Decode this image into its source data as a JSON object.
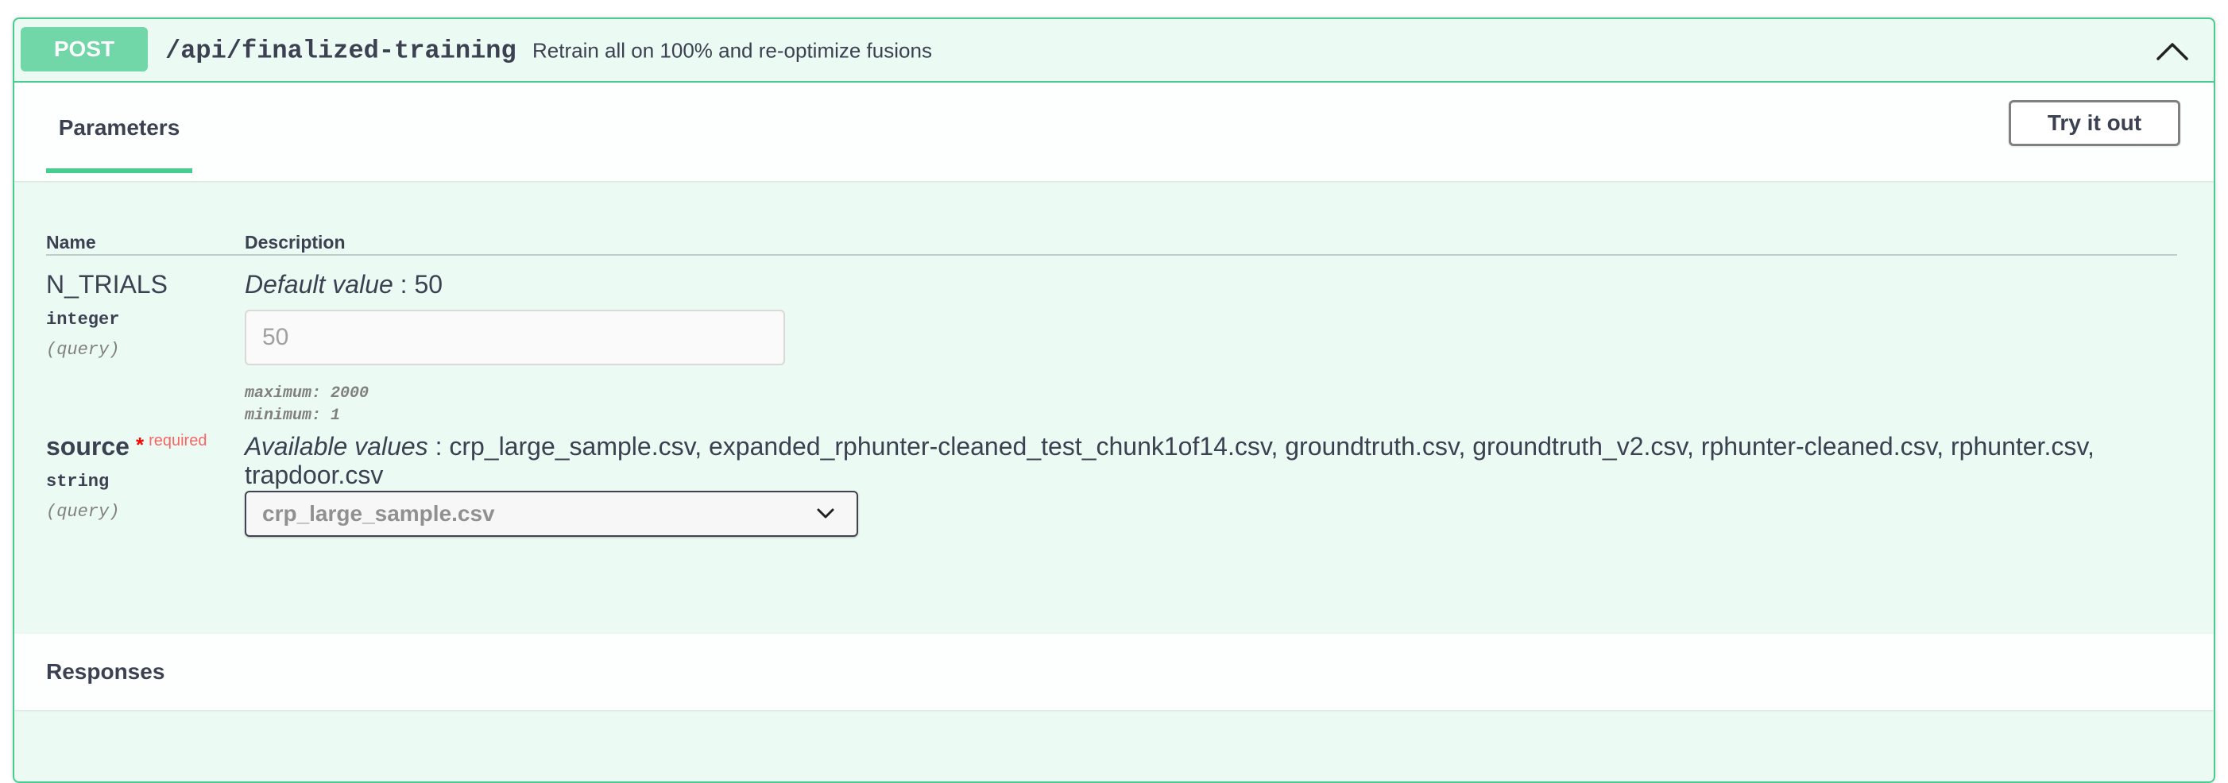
{
  "operation": {
    "method": "POST",
    "path": "/api/finalized-training",
    "summary": "Retrain all on 100% and re-optimize fusions",
    "collapse_icon": "chevron-up-icon",
    "accent_color": "#49cc90"
  },
  "tabs": {
    "parameters_label": "Parameters",
    "try_it_out_label": "Try it out"
  },
  "table": {
    "col_name": "Name",
    "col_description": "Description"
  },
  "params": [
    {
      "name": "N_TRIALS",
      "type": "integer",
      "in": "(query)",
      "default_label": "Default value",
      "default_sep": " : ",
      "default_value": "50",
      "input_placeholder": "50",
      "maximum": "maximum: 2000",
      "minimum": "minimum: 1"
    },
    {
      "name": "source",
      "required_star": "*",
      "required_label": "required",
      "type": "string",
      "in": "(query)",
      "available_label": "Available values",
      "available_sep": " : ",
      "available_values_line1": "crp_large_sample.csv, expanded_rphunter-cleaned_test_chunk1of14.csv, groundtruth.csv, groundtruth_v2.csv, rphunter-cleaned.csv, rphunter.csv,",
      "available_values_line2": "trapdoor.csv",
      "selected_value": "crp_large_sample.csv",
      "select_icon": "chevron-down-icon"
    }
  ],
  "responses": {
    "title": "Responses"
  }
}
